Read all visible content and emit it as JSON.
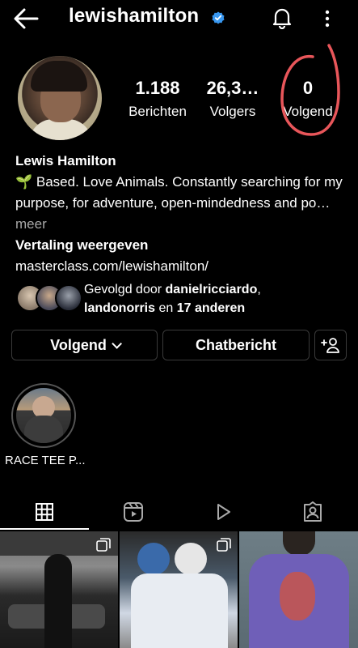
{
  "header": {
    "username": "lewishamilton"
  },
  "stats": [
    {
      "value": "1.188",
      "label": "Berichten"
    },
    {
      "value": "26,3…",
      "label": "Volgers"
    },
    {
      "value": "0",
      "label": "Volgend"
    }
  ],
  "bio": {
    "name": "Lewis Hamilton",
    "text_prefix": "🌱 Based. Love Animals. Constantly searching for my purpose, for adventure, open-mindedness and po…",
    "more": " meer",
    "translate": "Vertaling weergeven",
    "link": "masterclass.com/lewishamilton/"
  },
  "followed_by": {
    "prefix": "Gevolgd door ",
    "user1": "danielricciardo",
    "sep": ",",
    "user2": "landonorris",
    "mid": " en ",
    "others": "17 anderen"
  },
  "buttons": {
    "follow": "Volgend",
    "message": "Chatbericht"
  },
  "highlight": {
    "label": "RACE TEE P..."
  },
  "colors": {
    "accent_verified": "#3897f0",
    "annotation_circle": "#e8565a"
  }
}
